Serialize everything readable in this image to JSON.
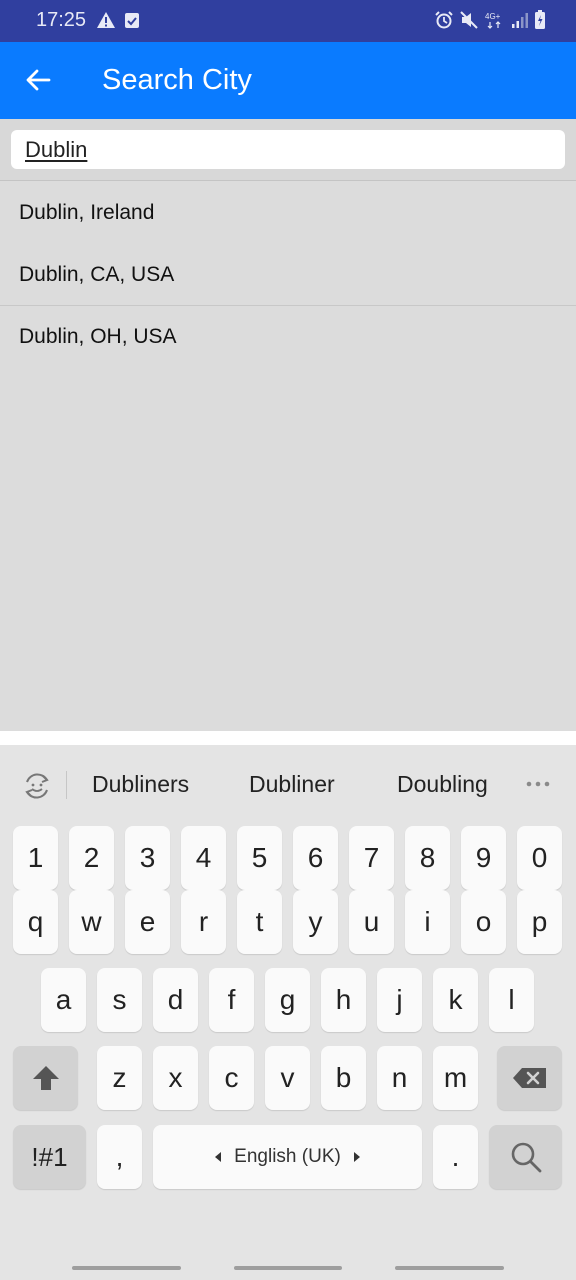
{
  "status_bar": {
    "time": "17:25",
    "left_icons": [
      "warning-icon",
      "task-check-icon"
    ],
    "right_icons": [
      "alarm-icon",
      "mute-icon",
      "network-4g-icon",
      "signal-icon",
      "battery-charging-icon"
    ],
    "network_label": "4G+"
  },
  "app_bar": {
    "title": "Search City",
    "back_icon": "arrow-back-icon"
  },
  "search": {
    "value": "Dublin"
  },
  "results": [
    {
      "label": "Dublin, Ireland"
    },
    {
      "label": "Dublin, CA, USA"
    },
    {
      "label": "Dublin, OH, USA"
    }
  ],
  "keyboard": {
    "suggestions": [
      "Dubliners",
      "Dubliner",
      "Doubling"
    ],
    "number_row": [
      "1",
      "2",
      "3",
      "4",
      "5",
      "6",
      "7",
      "8",
      "9",
      "0"
    ],
    "row1": [
      "q",
      "w",
      "e",
      "r",
      "t",
      "y",
      "u",
      "i",
      "o",
      "p"
    ],
    "row2": [
      "a",
      "s",
      "d",
      "f",
      "g",
      "h",
      "j",
      "k",
      "l"
    ],
    "row3": [
      "z",
      "x",
      "c",
      "v",
      "b",
      "n",
      "m"
    ],
    "symbols_label": "!#1",
    "comma_label": ",",
    "space_label": "English (UK)",
    "period_label": ".",
    "icons": [
      "emoji-toggle-icon",
      "more-icon",
      "shift-icon",
      "backspace-icon",
      "search-icon"
    ]
  },
  "colors": {
    "status_bar": "#303f9f",
    "app_bar": "#0a7bff",
    "background": "#dcdcdc",
    "keyboard": "#e4e4e4"
  }
}
